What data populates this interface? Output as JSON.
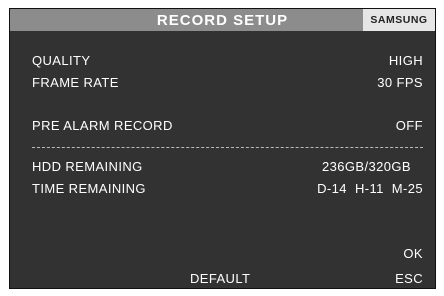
{
  "header": {
    "title": "RECORD SETUP",
    "brand": "SAMSUNG"
  },
  "settings": {
    "quality": {
      "label": "QUALITY",
      "value": "HIGH"
    },
    "frame_rate": {
      "label": "FRAME RATE",
      "value": "30 FPS"
    },
    "pre_alarm": {
      "label": "PRE ALARM RECORD",
      "value": "OFF"
    },
    "hdd_remaining": {
      "label": "HDD REMAINING",
      "value": "236GB/320GB"
    },
    "time_remaining": {
      "label": "TIME REMAINING",
      "value": "D-14  H-11  M-25"
    }
  },
  "buttons": {
    "ok": "OK",
    "default": "DEFAULT",
    "esc": "ESC"
  },
  "colors": {
    "background": "#323232",
    "title_bar": "#8c8c8c",
    "brand_box": "#e6e6e6",
    "text": "#ffffff"
  }
}
